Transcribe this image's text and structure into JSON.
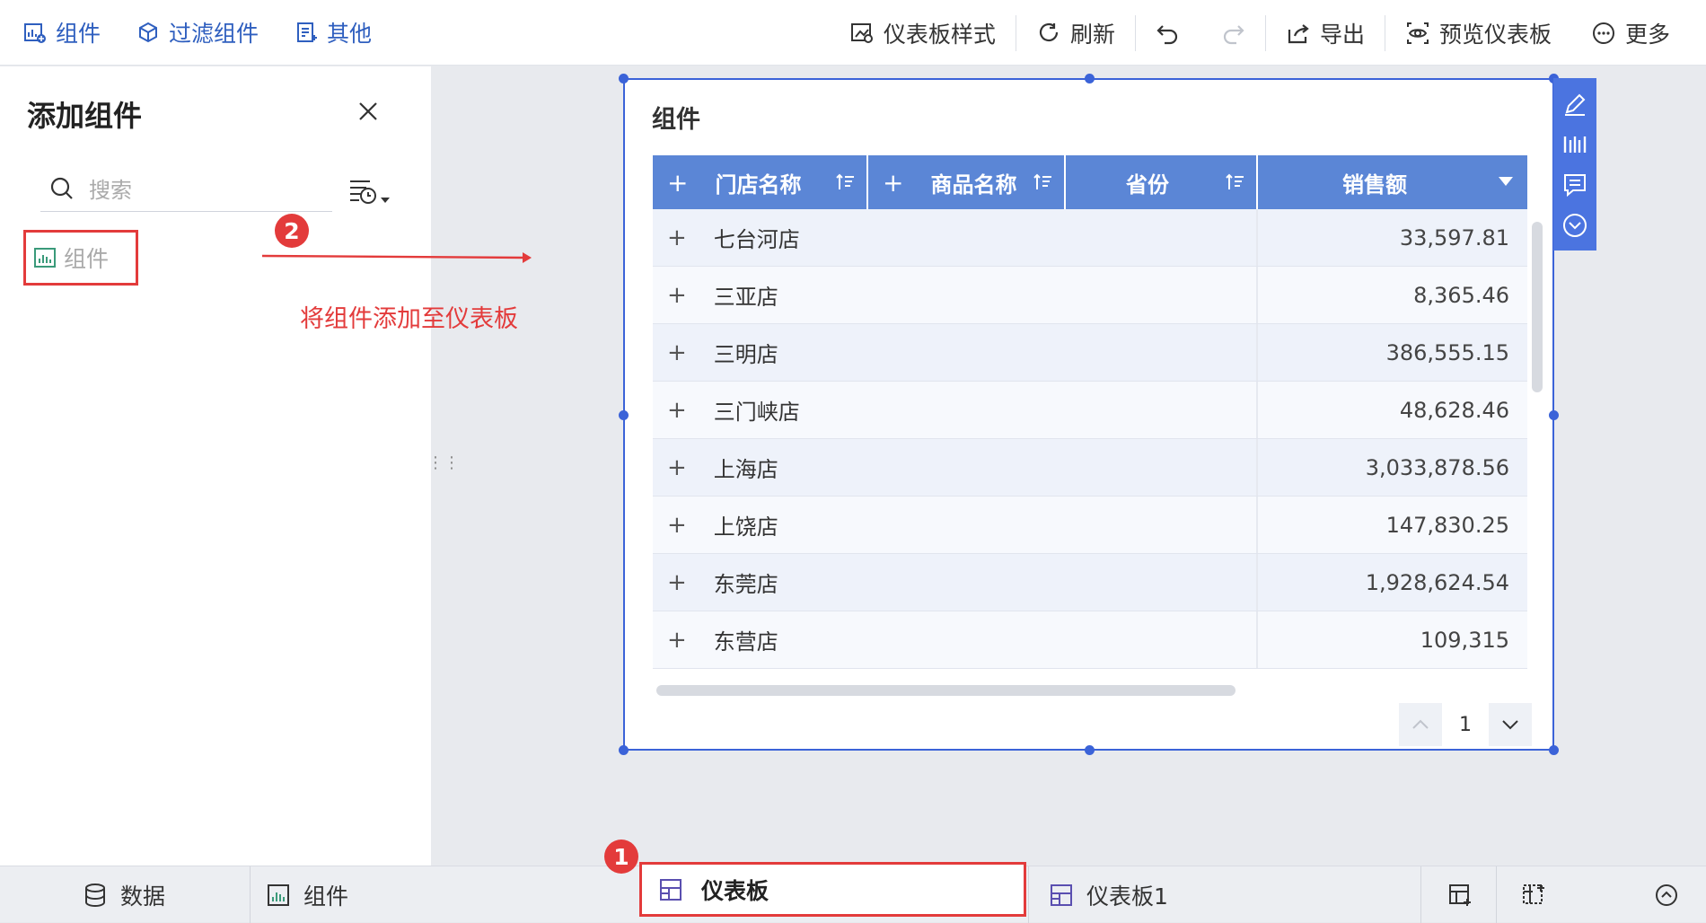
{
  "toolbar": {
    "left": [
      {
        "label": "组件",
        "icon": "add-chart-icon"
      },
      {
        "label": "过滤组件",
        "icon": "filter-cube-icon"
      },
      {
        "label": "其他",
        "icon": "other-doc-icon"
      }
    ],
    "right": {
      "style": "仪表板样式",
      "refresh": "刷新",
      "export": "导出",
      "preview": "预览仪表板",
      "more": "更多"
    }
  },
  "sidebar": {
    "title": "添加组件",
    "search_placeholder": "搜索",
    "component_item": "组件"
  },
  "annotations": {
    "step1": "1",
    "step2": "2",
    "hint": "将组件添加至仪表板"
  },
  "widget": {
    "title": "组件",
    "columns": [
      "门店名称",
      "商品名称",
      "省份",
      "销售额"
    ],
    "rows": [
      {
        "store": "七台河店",
        "sales": "33,597.81"
      },
      {
        "store": "三亚店",
        "sales": "8,365.46"
      },
      {
        "store": "三明店",
        "sales": "386,555.15"
      },
      {
        "store": "三门峡店",
        "sales": "48,628.46"
      },
      {
        "store": "上海店",
        "sales": "3,033,878.56"
      },
      {
        "store": "上饶店",
        "sales": "147,830.25"
      },
      {
        "store": "东莞店",
        "sales": "1,928,624.54"
      },
      {
        "store": "东营店",
        "sales": "109,315"
      }
    ],
    "page": "1"
  },
  "bottom": {
    "data": "数据",
    "component": "组件",
    "dashboard": "仪表板",
    "dashboard1": "仪表板1"
  },
  "colors": {
    "accent": "#3b63d8",
    "header": "#5b86d6",
    "annotation": "#e33b3b"
  }
}
